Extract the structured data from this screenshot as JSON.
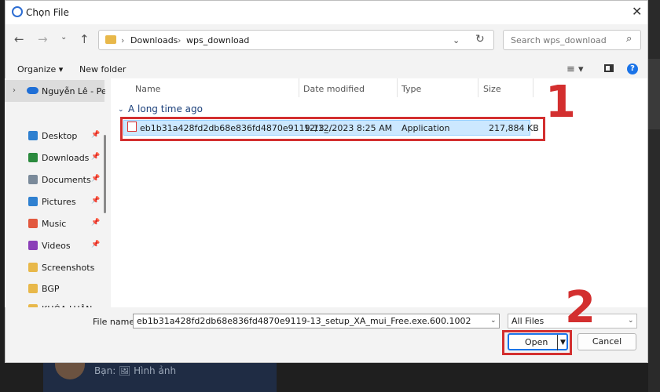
{
  "background": {
    "chat_preview": "Bạn: 🖼 Hình ảnh"
  },
  "window": {
    "title": "Chọn File"
  },
  "address_bar": {
    "crumbs": [
      "Downloads",
      "wps_download"
    ],
    "separator": "›"
  },
  "search": {
    "placeholder": "Search wps_download"
  },
  "toolbar": {
    "organize": "Organize ▾",
    "new_folder": "New folder"
  },
  "nav_pane": {
    "account": "Nguyễn Lê - Per",
    "items": [
      {
        "label": "Desktop",
        "icon": "desktop-icon",
        "color": "#2f80d0",
        "pinned": true
      },
      {
        "label": "Downloads",
        "icon": "downloads-icon",
        "color": "#2b8a3e",
        "pinned": true
      },
      {
        "label": "Documents",
        "icon": "documents-icon",
        "color": "#7a8a9a",
        "pinned": true
      },
      {
        "label": "Pictures",
        "icon": "pictures-icon",
        "color": "#2f80d0",
        "pinned": true
      },
      {
        "label": "Music",
        "icon": "music-icon",
        "color": "#e2583e",
        "pinned": true
      },
      {
        "label": "Videos",
        "icon": "videos-icon",
        "color": "#8b3fb8",
        "pinned": true
      },
      {
        "label": "Screenshots",
        "icon": "folder-icon",
        "color": "#e8b84a",
        "pinned": false
      },
      {
        "label": "BGP",
        "icon": "folder-icon",
        "color": "#e8b84a",
        "pinned": false
      },
      {
        "label": "KHÓA LUẬN",
        "icon": "folder-icon",
        "color": "#e8b84a",
        "pinned": false
      }
    ]
  },
  "columns": [
    "Name",
    "Date modified",
    "Type",
    "Size"
  ],
  "group": "A long time ago",
  "files": [
    {
      "name": "eb1b31a428fd2db68e836fd4870e9119-13_...",
      "date": "12/12/2023 8:25 AM",
      "type": "Application",
      "size": "217,884 KB"
    }
  ],
  "footer": {
    "file_name_label": "File name:",
    "file_name_value": "eb1b31a428fd2db68e836fd4870e9119-13_setup_XA_mui_Free.exe.600.1002",
    "filter": "All Files",
    "open": "Open",
    "cancel": "Cancel"
  },
  "annotations": {
    "step1": "1",
    "step2": "2",
    "color": "#d32f2f"
  }
}
